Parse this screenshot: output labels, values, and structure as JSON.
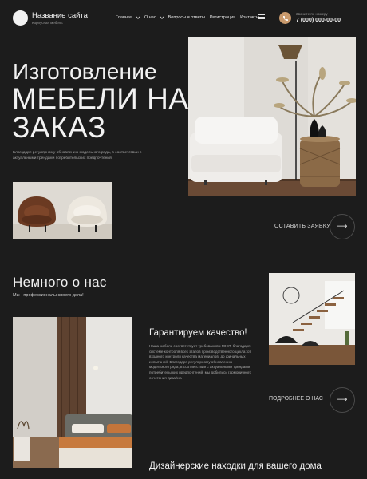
{
  "header": {
    "brand_name": "Название сайта",
    "brand_sub": "Корпусная мебель",
    "nav": [
      {
        "label": "Главная"
      },
      {
        "label": "О нас"
      },
      {
        "label": "Вопросы и ответы"
      },
      {
        "label": "Регистрация"
      },
      {
        "label": "Контакты"
      }
    ],
    "phone_label": "Звоните по номеру",
    "phone_number": "7 (000) 000-00-00"
  },
  "hero": {
    "line1": "Изготовление",
    "line2": "МЕБЕЛИ НА ЗАКАЗ",
    "description": "Благодаря регулярному обновлению модельного ряда, в соответствии с актуальными трендами потребительских предпочтений",
    "cta_label": "ОСТАВИТЬ ЗАЯВКУ"
  },
  "about": {
    "title": "Немного о нас",
    "subtitle": "Мы - профессионалы своего дела!",
    "quality_title": "Гарантируем качество!",
    "quality_text": "Наша мебель соответствует требованиям ГОСТ, благодаря системе контроля всех этапов производственного цикла: от входного контроля качества материалов, до финальных испытаний. Благодаря регулярному обновлению модельного ряда, в соответствии с актуальными трендами потребительских предпочтений, мы добились гармоничного сочетания дизайна",
    "more_label": "ПОДРОБНЕЕ О НАС"
  },
  "design": {
    "title": "Дизайнерские находки для вашего дома"
  },
  "colors": {
    "background": "#1c1c1c",
    "accent": "#c99a6d"
  }
}
